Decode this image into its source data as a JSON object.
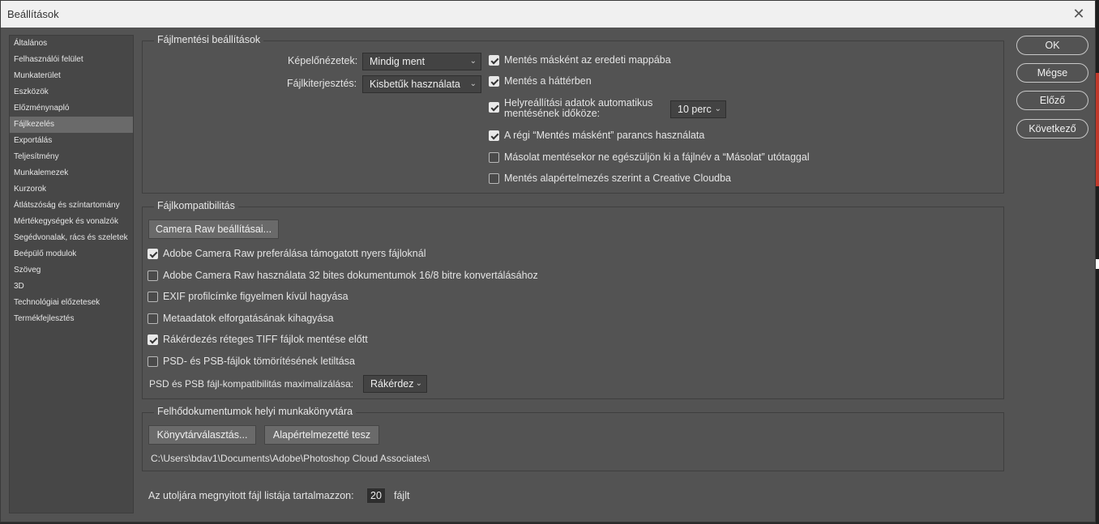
{
  "window": {
    "title": "Beállítások",
    "close_glyph": "✕"
  },
  "sidebar": {
    "items": [
      {
        "label": "Általános"
      },
      {
        "label": "Felhasználói felület"
      },
      {
        "label": "Munkaterület"
      },
      {
        "label": "Eszközök"
      },
      {
        "label": "Előzménynapló"
      },
      {
        "label": "Fájlkezelés",
        "active": true
      },
      {
        "label": "Exportálás"
      },
      {
        "label": "Teljesítmény"
      },
      {
        "label": "Munkalemezek"
      },
      {
        "label": "Kurzorok"
      },
      {
        "label": "Átlátszóság és színtartomány"
      },
      {
        "label": "Mértékegységek és vonalzók"
      },
      {
        "label": "Segédvonalak, rács és szeletek"
      },
      {
        "label": "Beépülő modulok"
      },
      {
        "label": "Szöveg"
      },
      {
        "label": "3D"
      },
      {
        "label": "Technológiai előzetesek"
      },
      {
        "label": "Termékfejlesztés"
      }
    ]
  },
  "file_saving": {
    "title": "Fájlmentési beállítások",
    "image_previews_label": "Képelőnézetek:",
    "image_previews_value": "Mindig ment",
    "file_extension_label": "Fájlkiterjesztés:",
    "file_extension_value": "Kisbetűk használata",
    "checkboxes": [
      {
        "label": "Mentés másként az eredeti mappába",
        "checked": true
      },
      {
        "label": "Mentés a háttérben",
        "checked": true
      },
      {
        "label": "Helyreállítási adatok automatikus\nmentésének időköze:",
        "checked": true
      },
      {
        "label": "A régi “Mentés másként” parancs használata",
        "checked": true
      },
      {
        "label": "Másolat mentésekor ne egészüljön ki a fájlnév a “Másolat” utótaggal",
        "checked": false
      },
      {
        "label": "Mentés alapértelmezés szerint a Creative Cloudba",
        "checked": false
      }
    ],
    "autosave_interval_value": "10 perc"
  },
  "file_compat": {
    "title": "Fájlkompatibilitás",
    "camera_raw_button": "Camera Raw beállításai...",
    "checkboxes": [
      {
        "label": "Adobe Camera Raw preferálása támogatott nyers fájloknál",
        "checked": true
      },
      {
        "label": "Adobe Camera Raw használata 32 bites dokumentumok 16/8 bitre konvertálásához",
        "checked": false
      },
      {
        "label": "EXIF profilcímke figyelmen kívül hagyása",
        "checked": false
      },
      {
        "label": "Metaadatok elforgatásának kihagyása",
        "checked": false
      },
      {
        "label": "Rákérdezés réteges TIFF fájlok mentése előtt",
        "checked": true
      },
      {
        "label": "PSD- és PSB-fájlok tömörítésének letiltása",
        "checked": false
      }
    ],
    "maximize_label": "PSD és PSB fájl-kompatibilitás maximalizálása:",
    "maximize_value": "Rákérdez"
  },
  "cloud_docs": {
    "title": "Felhődokumentumok helyi munkakönyvtára",
    "choose_dir_button": "Könyvtárválasztás...",
    "reset_button": "Alapértelmezetté tesz",
    "path": "C:\\Users\\bdav1\\Documents\\Adobe\\Photoshop Cloud Associates\\"
  },
  "recent_files": {
    "label": "Az utoljára megnyitott fájl listája tartalmazzon:",
    "value": "20",
    "suffix": "fájlt"
  },
  "actions": {
    "ok": "OK",
    "cancel": "Mégse",
    "prev": "Előző",
    "next": "Következő"
  },
  "icons": {
    "dropdown": "chevron-down-icon",
    "close": "close-icon",
    "check": "checkmark-icon"
  }
}
